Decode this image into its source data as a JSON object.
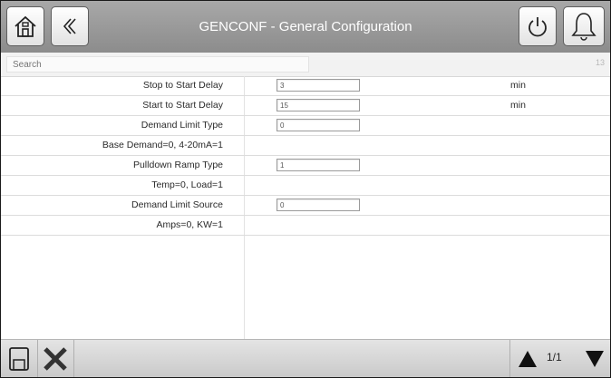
{
  "header": {
    "title": "GENCONF - General Configuration",
    "icons": [
      "home-icon",
      "double-chevron-left-icon",
      "power-icon",
      "bell-icon"
    ]
  },
  "search": {
    "placeholder": "Search",
    "count": "13"
  },
  "rows": [
    {
      "label": "Stop to Start Delay",
      "value": "3",
      "unit": "min"
    },
    {
      "label": "Start to Start Delay",
      "value": "15",
      "unit": "min"
    },
    {
      "label": "Demand Limit Type",
      "value": "0",
      "unit": ""
    },
    {
      "label": "Base Demand=0, 4-20mA=1",
      "value": null,
      "unit": ""
    },
    {
      "label": "Pulldown Ramp Type",
      "value": "1",
      "unit": ""
    },
    {
      "label": "Temp=0, Load=1",
      "value": null,
      "unit": ""
    },
    {
      "label": "Demand Limit Source",
      "value": "0",
      "unit": ""
    },
    {
      "label": "Amps=0, KW=1",
      "value": null,
      "unit": ""
    }
  ],
  "footer": {
    "page": "1/1",
    "icons": [
      "save-icon",
      "cancel-x-icon",
      "page-up-icon",
      "page-down-icon"
    ]
  }
}
